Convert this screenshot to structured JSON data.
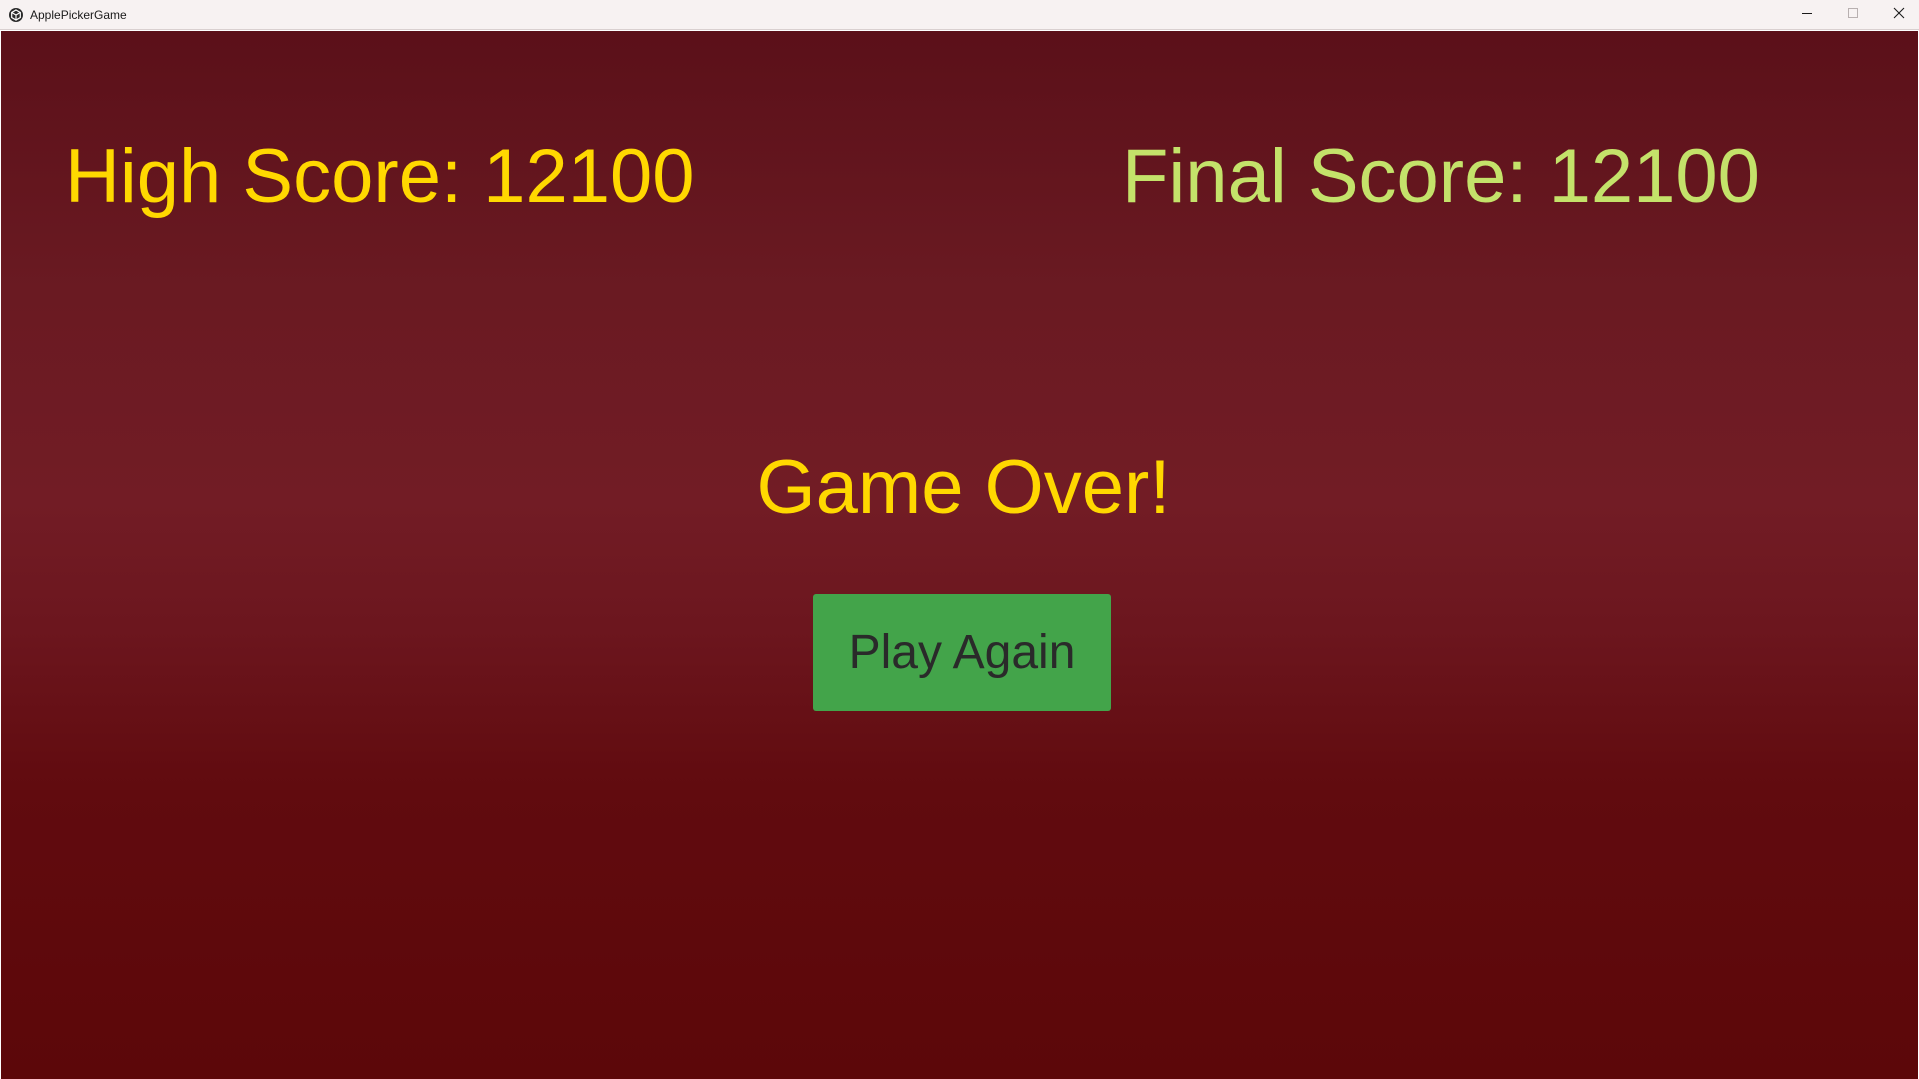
{
  "window": {
    "title": "ApplePickerGame",
    "app_icon": "unity-icon",
    "controls": {
      "minimize_icon": "minimize-icon",
      "maximize_icon": "maximize-icon",
      "close_icon": "close-icon"
    }
  },
  "game": {
    "high_score_text": "High Score: 12100",
    "final_score_text": "Final Score: 12100",
    "game_over_text": "Game Over!",
    "play_again_label": "Play Again"
  },
  "colors": {
    "high_score": "#ffd800",
    "final_score": "#c4e26a",
    "game_over": "#ffd800",
    "button_bg": "#43a44a",
    "button_text": "#2a2a2a",
    "background_top": "#5b1019",
    "background_bottom": "#5c0709"
  }
}
